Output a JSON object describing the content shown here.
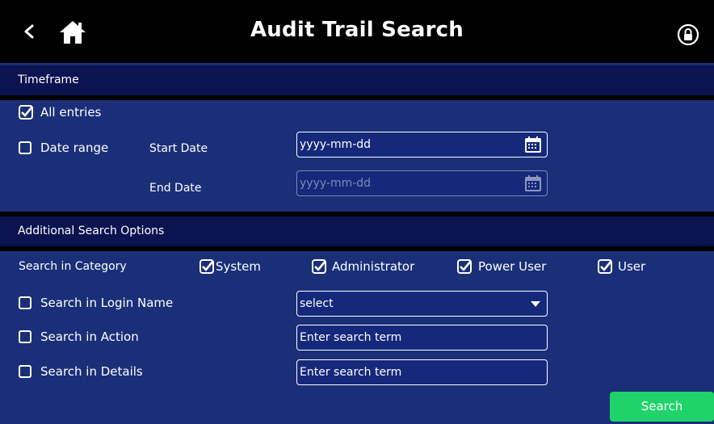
{
  "header": {
    "title": "Audit Trail Search"
  },
  "timeframe": {
    "section_title": "Timeframe",
    "all_entries": {
      "label": "All entries",
      "checked": true
    },
    "date_range": {
      "label": "Date range",
      "checked": false
    },
    "start_date_label": "Start Date",
    "start_date_placeholder": "yyyy-mm-dd",
    "end_date_label": "End Date",
    "end_date_placeholder": "yyyy-mm-dd"
  },
  "additional": {
    "section_title": "Additional Search Options",
    "category_label": "Search in Category",
    "categories": [
      {
        "label": "System",
        "checked": true
      },
      {
        "label": "Administrator",
        "checked": true
      },
      {
        "label": "Power User",
        "checked": true
      },
      {
        "label": "User",
        "checked": true
      }
    ],
    "login_name": {
      "label": "Search in Login Name",
      "checked": false,
      "value": "select"
    },
    "action": {
      "label": "Search in Action",
      "checked": false,
      "placeholder": "Enter search term"
    },
    "details": {
      "label": "Search in Details",
      "checked": false,
      "placeholder": "Enter search term"
    }
  },
  "search_button": "Search",
  "colors": {
    "header_bg": "#000000",
    "panel_bg": "#1a2f78",
    "section_bg": "#0b1450",
    "accent": "#1fd36a"
  },
  "icons": [
    "back-icon",
    "home-icon",
    "lock-icon",
    "calendar-icon",
    "chevron-down-icon",
    "checkbox-checked-icon"
  ]
}
